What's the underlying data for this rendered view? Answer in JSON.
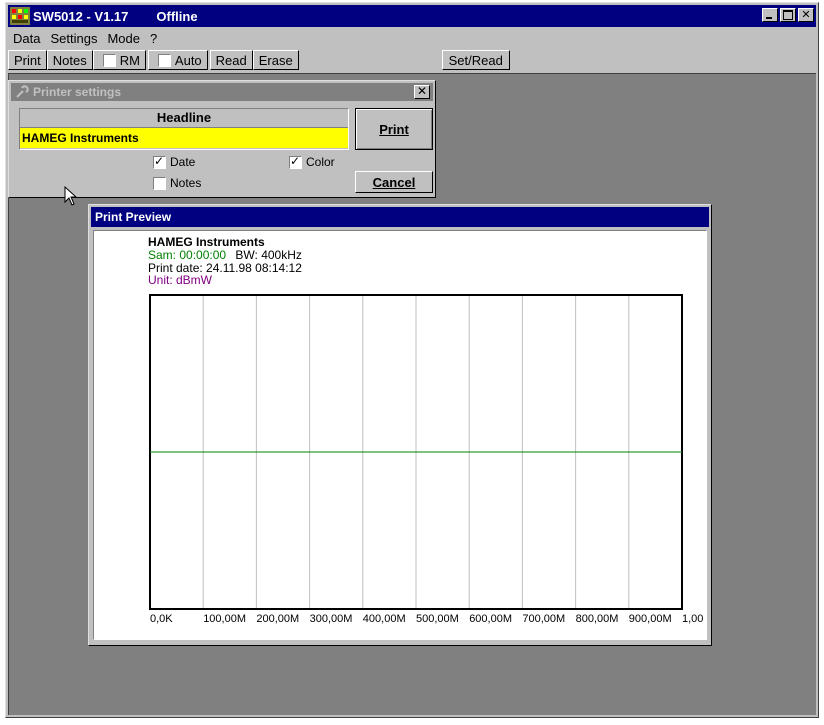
{
  "window": {
    "app_name": "SW5012 - V1.17",
    "status": "Offline",
    "controls": {
      "minimize": "_",
      "maximize": "□",
      "close": "✕"
    }
  },
  "menu": [
    "Data",
    "Settings",
    "Mode",
    "?"
  ],
  "toolbar": {
    "print": "Print",
    "notes": "Notes",
    "rm": "RM",
    "auto": "Auto",
    "read": "Read",
    "erase": "Erase",
    "set_read": "Set/Read",
    "rm_checked": false,
    "auto_checked": false
  },
  "printer_settings": {
    "title": "Printer settings",
    "close": "✕",
    "headline_label": "Headline",
    "headline_value": "HAMEG Instruments",
    "date_label": "Date",
    "date_checked": true,
    "color_label": "Color",
    "color_checked": true,
    "notes_label": "Notes",
    "notes_checked": false,
    "print_button": "Print",
    "cancel_button": "Cancel"
  },
  "print_preview": {
    "title": "Print Preview",
    "headline": "HAMEG Instruments",
    "sam_label": "Sam: 00:00:00",
    "bw_label": "BW: 400kHz",
    "print_date": "Print date: 24.11.98 08:14:12",
    "unit": "Unit: dBmW"
  },
  "chart_data": {
    "type": "line",
    "title": "",
    "xlabel": "",
    "ylabel": "",
    "x_tick_labels": [
      "0,0K",
      "100,00M",
      "200,00M",
      "300,00M",
      "400,00M",
      "500,00M",
      "600,00M",
      "700,00M",
      "800,00M",
      "900,00M",
      "1,00"
    ],
    "x": [
      0,
      1000
    ],
    "ylim": [
      0,
      1
    ],
    "grid": true,
    "series": [
      {
        "values": [
          0.5,
          0.5
        ],
        "color": "#008000"
      }
    ]
  },
  "colors": {
    "title_active": "#000080",
    "title_inactive": "#808080",
    "face": "#c0c0c0",
    "workspace": "#808080",
    "headline_bg": "#ffff00",
    "sam_text": "#008000",
    "unit_text": "#800080",
    "trace": "#008000"
  }
}
